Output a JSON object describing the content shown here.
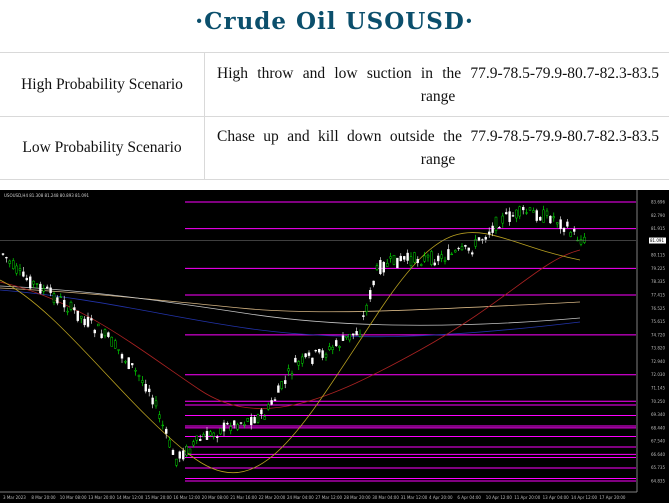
{
  "title": "·Crude   Oil   USOUSD·",
  "scenarios": [
    {
      "label": "High Probability Scenario",
      "text": "High throw and low suction in the 77.9-78.5-79.9-80.7-82.3-83.5 range"
    },
    {
      "label": "Low Probability Scenario",
      "text": "Chase up and kill down outside the 77.9-78.5-79.9-80.7-82.3-83.5 range"
    }
  ],
  "chart": {
    "symbol_line": "USOUSD,H4  81.308 81.248 80.893 81.091",
    "price_labels": [
      "83.696",
      "82.790",
      "81.915",
      "81.003",
      "80.115",
      "79.225",
      "78.335",
      "77.415",
      "76.525",
      "75.615",
      "74.720",
      "73.820",
      "72.940",
      "72.030",
      "71.145",
      "70.250",
      "69.340",
      "68.440",
      "67.540",
      "66.640",
      "65.735",
      "64.835"
    ],
    "current_price": "81.091",
    "date_labels": [
      "3 Mar 2023",
      "8 Mar 20:00",
      "10 Mar 08:00",
      "13 Mar 20:00",
      "14 Mar 12:00",
      "15 Mar 20:00",
      "16 Mar 12:00",
      "20 Mar 08:00",
      "21 Mar 16:00",
      "22 Mar 20:00",
      "24 Mar 04:00",
      "27 Mar 12:00",
      "28 Mar 20:00",
      "30 Mar 04:00",
      "31 Mar 12:00",
      "4 Apr 20:00",
      "6 Apr 04:00",
      "10 Apr 12:00",
      "11 Apr 20:00",
      "13 Apr 04:00",
      "14 Apr 12:00",
      "17 Apr 20:00"
    ],
    "colors": {
      "background": "#000000",
      "bull": "#00ff00",
      "bear": "#ffffff",
      "level_line": "#ff00ff",
      "axis": "#808080"
    }
  }
}
